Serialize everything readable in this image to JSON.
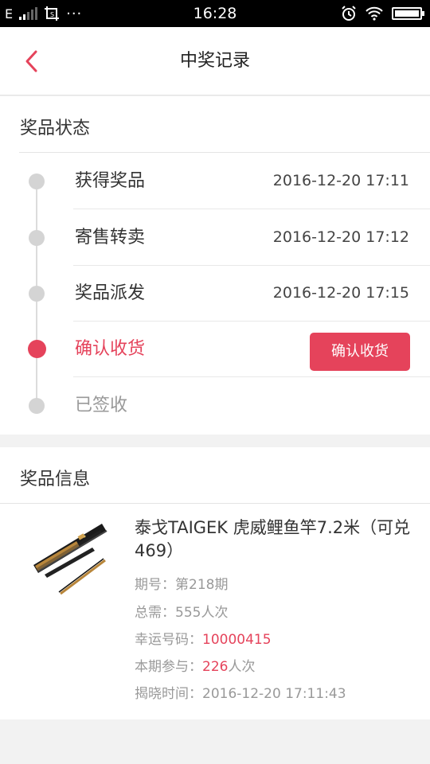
{
  "status_bar": {
    "carrier": "E",
    "time": "16:28",
    "more": "···"
  },
  "header": {
    "title": "中奖记录"
  },
  "status_section": {
    "title": "奖品状态",
    "steps": [
      {
        "label": "获得奖品",
        "time": "2016-12-20 17:11",
        "state": "done"
      },
      {
        "label": "寄售转卖",
        "time": "2016-12-20 17:12",
        "state": "done"
      },
      {
        "label": "奖品派发",
        "time": "2016-12-20 17:15",
        "state": "done"
      },
      {
        "label": "确认收货",
        "button": "确认收货",
        "state": "current"
      },
      {
        "label": "已签收",
        "state": "pending"
      }
    ]
  },
  "info_section": {
    "title": "奖品信息",
    "product_name": "泰戈TAIGEK 虎威鲤鱼竿7.2米（可兑469）",
    "period_label": "期号：",
    "period_value": "第218期",
    "need_label": "总需：",
    "need_value": "555人次",
    "lucky_label": "幸运号码：",
    "lucky_value": "10000415",
    "joined_label": "本期参与：",
    "joined_value": "226",
    "joined_unit": "人次",
    "reveal_label": "揭晓时间：",
    "reveal_value": "2016-12-20 17:11:43"
  },
  "colors": {
    "accent": "#e5435b",
    "inactive_dot": "#d4d4d4"
  },
  "icons": {
    "back": "chevron-left-icon",
    "product": "fishing-rod-image"
  }
}
